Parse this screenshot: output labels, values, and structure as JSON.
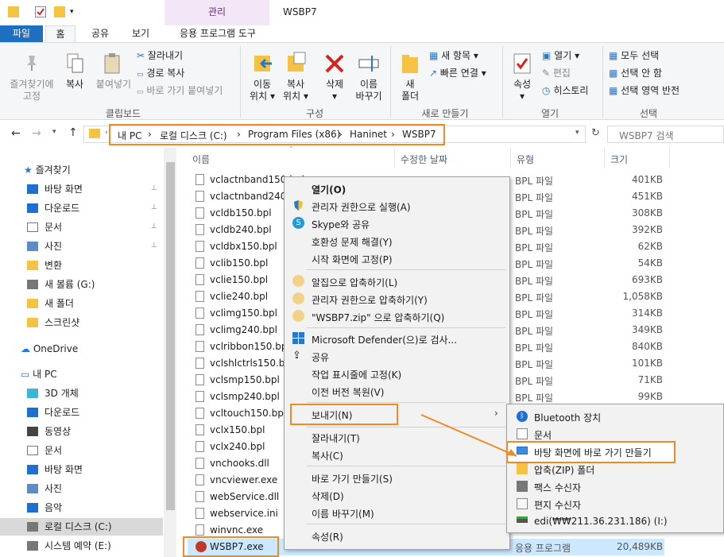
{
  "window": {
    "title": "WSBP7",
    "context_tab_header": "관리"
  },
  "tabs": {
    "file": "파일",
    "home": "홈",
    "share": "공유",
    "view": "보기",
    "app_tools": "응용 프로그램 도구"
  },
  "ribbon": {
    "clipboard": {
      "pin": "즐겨찾기에\n고정",
      "pin_l1": "즐겨찾기에",
      "pin_l2": "고정",
      "copy": "복사",
      "paste": "붙여넣기",
      "cut": "잘라내기",
      "copy_path": "경로 복사",
      "paste_shortcut": "바로 가기 붙여넣기",
      "group": "클립보드"
    },
    "organize": {
      "move_l1": "이동",
      "move_l2": "위치",
      "copy_l1": "복사",
      "copy_l2": "위치",
      "delete": "삭제",
      "rename_l1": "이름",
      "rename_l2": "바꾸기",
      "group": "구성"
    },
    "new": {
      "folder_l1": "새",
      "folder_l2": "폴더",
      "new_item": "새 항목",
      "easy_access": "빠른 연결",
      "group": "새로 만들기"
    },
    "open": {
      "properties": "속성",
      "open": "열기",
      "edit": "편집",
      "history": "히스토리",
      "group": "열기"
    },
    "select": {
      "select_all": "모두 선택",
      "select_none": "선택 안 함",
      "invert": "선택 영역 반전",
      "group": "선택"
    }
  },
  "address": {
    "crumbs": [
      "내 PC",
      "로컬 디스크 (C:)",
      "Program Files (x86)",
      "Haninet",
      "WSBP7"
    ],
    "search_placeholder": "WSBP7 검색"
  },
  "nav": {
    "quick_access": "즐겨찾기",
    "items": [
      {
        "label": "바탕 화면"
      },
      {
        "label": "다운로드"
      },
      {
        "label": "문서"
      },
      {
        "label": "사진"
      },
      {
        "label": "변환"
      },
      {
        "label": "새 볼륨 (G:)"
      },
      {
        "label": "새 폴더"
      },
      {
        "label": "스크린샷"
      }
    ],
    "onedrive": "OneDrive",
    "this_pc": "내 PC",
    "pc_items": [
      {
        "label": "3D 개체"
      },
      {
        "label": "다운로드"
      },
      {
        "label": "동영상"
      },
      {
        "label": "문서"
      },
      {
        "label": "바탕 화면"
      },
      {
        "label": "사진"
      },
      {
        "label": "음악"
      },
      {
        "label": "로컬 디스크 (C:)"
      },
      {
        "label": "시스템 예약 (E:)"
      }
    ]
  },
  "list": {
    "columns": {
      "name": "이름",
      "date": "수정한 날짜",
      "type": "유형",
      "size": "크기"
    },
    "rows": [
      {
        "name": "vclactnband150.bpl",
        "type": "BPL 파일",
        "size": "401KB"
      },
      {
        "name": "vclactnband240.bpl",
        "type": "BPL 파일",
        "size": "451KB"
      },
      {
        "name": "vcldb150.bpl",
        "type": "BPL 파일",
        "size": "308KB"
      },
      {
        "name": "vcldb240.bpl",
        "type": "BPL 파일",
        "size": "392KB"
      },
      {
        "name": "vcldbx150.bpl",
        "type": "BPL 파일",
        "size": "62KB"
      },
      {
        "name": "vclib150.bpl",
        "type": "BPL 파일",
        "size": "54KB"
      },
      {
        "name": "vclie150.bpl",
        "type": "BPL 파일",
        "size": "693KB"
      },
      {
        "name": "vclie240.bpl",
        "type": "BPL 파일",
        "size": "1,058KB"
      },
      {
        "name": "vclimg150.bpl",
        "type": "BPL 파일",
        "size": "314KB"
      },
      {
        "name": "vclimg240.bpl",
        "type": "BPL 파일",
        "size": "349KB"
      },
      {
        "name": "vclribbon150.bpl",
        "type": "BPL 파일",
        "size": "840KB"
      },
      {
        "name": "vclshlctrls150.bpl",
        "type": "BPL 파일",
        "size": "101KB"
      },
      {
        "name": "vclsmp150.bpl",
        "type": "BPL 파일",
        "size": "71KB"
      },
      {
        "name": "vclsmp240.bpl",
        "type": "BPL 파일",
        "size": "99KB"
      },
      {
        "name": "vcltouch150.bpl",
        "type": "",
        "size": ""
      },
      {
        "name": "vclx150.bpl",
        "type": "",
        "size": ""
      },
      {
        "name": "vclx240.bpl",
        "type": "",
        "size": ""
      },
      {
        "name": "vnchooks.dll",
        "type": "",
        "size": ""
      },
      {
        "name": "vncviewer.exe",
        "type": "",
        "size": ""
      },
      {
        "name": "webService.dll",
        "type": "",
        "size": ""
      },
      {
        "name": "webservice.ini",
        "type": "",
        "size": ""
      },
      {
        "name": "winvnc.exe",
        "type": "",
        "size": ""
      }
    ],
    "selected": {
      "name": "WSBP7.exe",
      "type": "응용 프로그램",
      "size": "20,489KB"
    }
  },
  "context_menu": {
    "open": "열기(O)",
    "run_admin": "관리자 권한으로 실행(A)",
    "skype": "Skype와 공유",
    "compat": "호환성 문제 해결(Y)",
    "pin_start": "시작 화면에 고정(P)",
    "compress_alzip": "알집으로 압축하기(L)",
    "compress_admin": "관리자 권한으로 압축하기(Y)",
    "compress_zip": "\"WSBP7.zip\" 으로 압축하기(Q)",
    "defender": "Microsoft Defender(으)로 검사...",
    "share": "공유",
    "pin_taskbar": "작업 표시줄에 고정(K)",
    "restore": "이전 버전 복원(V)",
    "send_to": "보내기(N)",
    "cut": "잘라내기(T)",
    "copy": "복사(C)",
    "create_shortcut": "바로 가기 만들기(S)",
    "delete": "삭제(D)",
    "rename": "이름 바꾸기(M)",
    "properties": "속성(R)"
  },
  "submenu": {
    "bluetooth": "Bluetooth 장치",
    "documents": "문서",
    "desktop_shortcut": "바탕 화면에 바로 가기 만들기",
    "zip": "압축(ZIP) 폴더",
    "fax": "팩스 수신자",
    "mail": "편지 수신자",
    "network_drive": "edi(₩₩211.36.231.186) (I:)"
  },
  "colors": {
    "accent": "#1f6fc0",
    "highlight": "#f08a24",
    "selection": "#cce8ff"
  }
}
